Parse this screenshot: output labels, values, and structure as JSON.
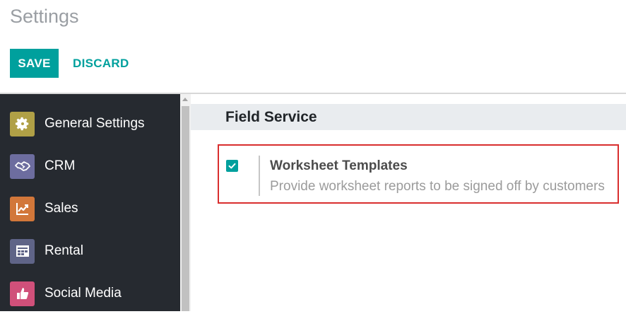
{
  "header": {
    "title": "Settings",
    "save_label": "SAVE",
    "discard_label": "DISCARD"
  },
  "colors": {
    "accent": "#00a09d",
    "sidebar_bg": "#262a30",
    "highlight_border": "#d92e2e"
  },
  "sidebar": {
    "items": [
      {
        "label": "General Settings",
        "icon": "gear-icon",
        "icon_color": "#b0a046"
      },
      {
        "label": "CRM",
        "icon": "handshake-icon",
        "icon_color": "#6d6d9f"
      },
      {
        "label": "Sales",
        "icon": "chart-icon",
        "icon_color": "#d2773a"
      },
      {
        "label": "Rental",
        "icon": "calendar-grid-icon",
        "icon_color": "#5f6487"
      },
      {
        "label": "Social Media",
        "icon": "thumbs-up-icon",
        "icon_color": "#d0507a"
      }
    ]
  },
  "main": {
    "section_title": "Field Service",
    "setting": {
      "title": "Worksheet Templates",
      "description": "Provide worksheet reports to be signed off by customers",
      "checked": true
    }
  }
}
